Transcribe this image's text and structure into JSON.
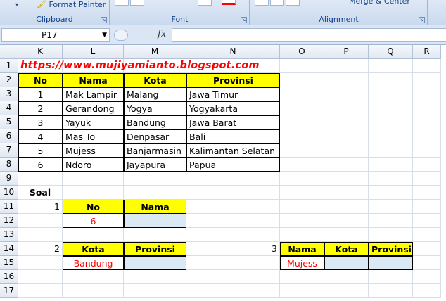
{
  "ribbon": {
    "format_painter": "Format Painter",
    "merge_center": "Merge & Center",
    "groups": {
      "clipboard": "Clipboard",
      "font": "Font",
      "alignment": "Alignment"
    }
  },
  "formula_bar": {
    "name_box": "P17",
    "fx": "fx",
    "formula": ""
  },
  "columns": [
    "K",
    "L",
    "M",
    "N",
    "O",
    "P",
    "Q",
    "R"
  ],
  "rows": [
    "1",
    "2",
    "3",
    "4",
    "5",
    "6",
    "7",
    "8",
    "9",
    "10",
    "11",
    "12",
    "13",
    "14",
    "15",
    "16",
    "17"
  ],
  "sheet": {
    "url": "https://www.mujiyamianto.blogspot.com",
    "table_headers": [
      "No",
      "Nama",
      "Kota",
      "Provinsi"
    ],
    "table_rows": [
      [
        "1",
        "Mak Lampir",
        "Malang",
        "Jawa Timur"
      ],
      [
        "2",
        "Gerandong",
        "Yogya",
        "Yogyakarta"
      ],
      [
        "3",
        "Yayuk",
        "Bandung",
        "Jawa Barat"
      ],
      [
        "4",
        "Mas To",
        "Denpasar",
        "Bali"
      ],
      [
        "5",
        "Mujess",
        "Banjarmasin",
        "Kalimantan Selatan"
      ],
      [
        "6",
        "Ndoro",
        "Jayapura",
        "Papua"
      ]
    ],
    "soal_label": "Soal",
    "q1": {
      "number": "1",
      "headers": [
        "No",
        "Nama"
      ],
      "values": [
        "6",
        ""
      ]
    },
    "q2": {
      "number": "2",
      "headers": [
        "Kota",
        "Provinsi"
      ],
      "values": [
        "Bandung",
        ""
      ]
    },
    "q3": {
      "number": "3",
      "headers": [
        "Nama",
        "Kota",
        "Provinsi"
      ],
      "values": [
        "Mujess",
        "",
        ""
      ]
    }
  }
}
